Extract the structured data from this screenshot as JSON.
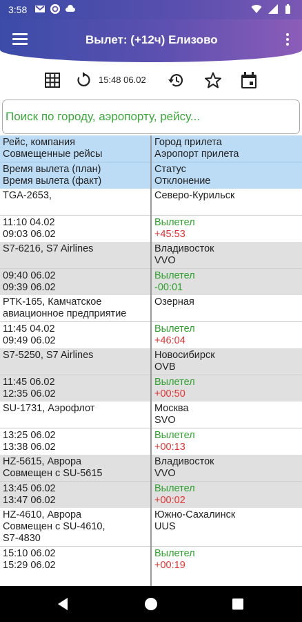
{
  "status": {
    "time": "3:58"
  },
  "appbar": {
    "title": "Вылет: (+12ч) Елизово"
  },
  "toolbar": {
    "updated": "15:48 06.02"
  },
  "search": {
    "placeholder": "Поиск по городу, аэропорту, рейсу..."
  },
  "header": {
    "left_top": [
      "Рейс, компания",
      "Совмещенные рейсы"
    ],
    "right_top": [
      "Город прилета",
      "Аэропорт прилета"
    ],
    "left_bottom": [
      "Время вылета (план)",
      "Время вылета (факт)"
    ],
    "right_bottom": [
      "Статус",
      "Отклонение"
    ]
  },
  "flights": [
    {
      "flight": [
        "TGA-2653,"
      ],
      "times": [
        "11:10 04.02",
        "09:03 06.02"
      ],
      "city": [
        "Северо-Курильск"
      ],
      "status": "Вылетел",
      "delay": "+45:53",
      "delay_color": "red"
    },
    {
      "flight": [
        "S7-6216, S7 Airlines"
      ],
      "times": [
        "09:40 06.02",
        "09:39 06.02"
      ],
      "city": [
        "Владивосток",
        "VVO"
      ],
      "status": "Вылетел",
      "delay": "-00:01",
      "delay_color": "green"
    },
    {
      "flight": [
        "PTK-165, Камчатское",
        "авиационное предприятие"
      ],
      "times": [
        "11:45 04.02",
        "09:49 06.02"
      ],
      "city": [
        "Озерная"
      ],
      "status": "Вылетел",
      "delay": "+46:04",
      "delay_color": "red"
    },
    {
      "flight": [
        "S7-5250, S7 Airlines"
      ],
      "times": [
        "11:45 06.02",
        "12:35 06.02"
      ],
      "city": [
        "Новосибирск",
        "OVB"
      ],
      "status": "Вылетел",
      "delay": "+00:50",
      "delay_color": "red"
    },
    {
      "flight": [
        "SU-1731, Аэрофлот"
      ],
      "times": [
        "13:25 06.02",
        "13:38 06.02"
      ],
      "city": [
        "Москва",
        "SVO"
      ],
      "status": "Вылетел",
      "delay": "+00:13",
      "delay_color": "red"
    },
    {
      "flight": [
        "HZ-5615, Аврора",
        "Совмещен с SU-5615"
      ],
      "times": [
        "13:45 06.02",
        "13:47 06.02"
      ],
      "city": [
        "Владивосток",
        "VVO"
      ],
      "status": "Вылетел",
      "delay": "+00:02",
      "delay_color": "red"
    },
    {
      "flight": [
        "HZ-4610, Аврора",
        "Совмещен с SU-4610,",
        "S7-4830"
      ],
      "times": [
        "15:10 06.02",
        "15:29 06.02"
      ],
      "city": [
        "Южно-Сахалинск",
        "UUS"
      ],
      "status": "Вылетел",
      "delay": "+00:19",
      "delay_color": "red"
    }
  ],
  "icons": {
    "statusbar": [
      "gmail-icon",
      "sync-icon",
      "cloud-icon",
      "wifi-icon",
      "signal-icon",
      "battery-icon"
    ],
    "toolbar": [
      "grid-icon",
      "refresh-icon",
      "history-icon",
      "star-icon",
      "calendar-icon"
    ],
    "navbar": [
      "back-icon",
      "home-icon",
      "recents-icon"
    ]
  },
  "colors": {
    "appbar_start": "#3b4ca8",
    "appbar_end": "#8b5db8",
    "header_bg": "#bcdcf5",
    "alt_row_bg": "#e0e0e0",
    "status_green": "#2ea22e",
    "delay_red": "#e23333"
  }
}
